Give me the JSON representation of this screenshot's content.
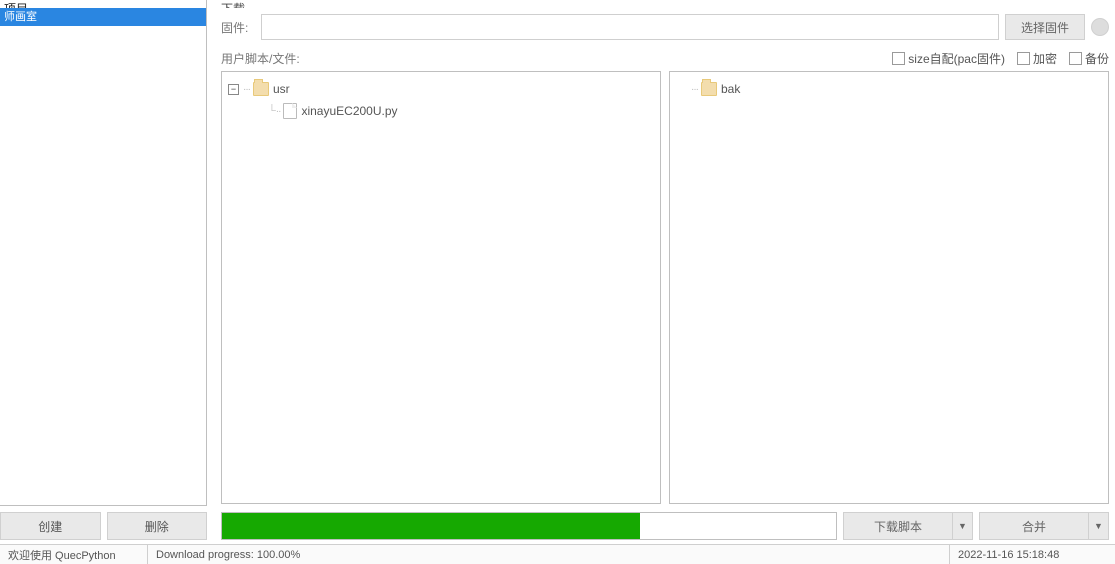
{
  "left": {
    "header_partial": "项目",
    "selected_item": "师画室",
    "create_btn": "创建",
    "delete_btn": "删除"
  },
  "right": {
    "top_partial": "下载",
    "firmware_label": "固件:",
    "firmware_value": "",
    "firmware_btn": "选择固件",
    "scriptfile_label": "用户脚本/文件:",
    "chk_size": "size自配(pac固件)",
    "chk_encrypt": "加密",
    "chk_backup": "备份"
  },
  "tree_left": {
    "root": "usr",
    "file1": "xinayuEC200U.py"
  },
  "tree_right": {
    "root": "bak"
  },
  "bottom": {
    "download_btn": "下载脚本",
    "merge_btn": "合并"
  },
  "status": {
    "welcome": "欢迎使用 QuecPython",
    "progress_text": "Download progress: 100.00%",
    "timestamp": "2022-11-16 15:18:48"
  }
}
